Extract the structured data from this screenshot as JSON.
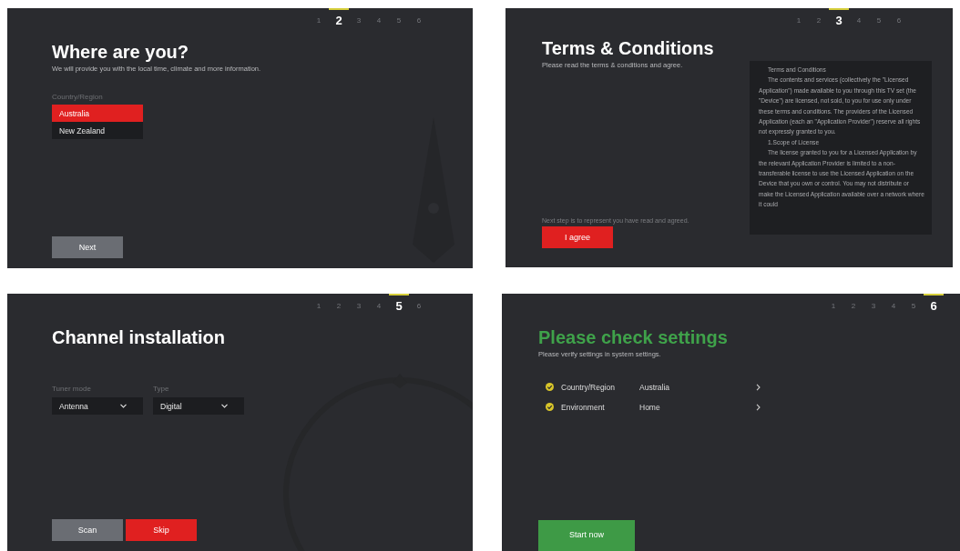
{
  "panels": [
    {
      "kind": "location",
      "steps": [
        {
          "label": "1",
          "selected": false
        },
        {
          "label": "2",
          "selected": true
        },
        {
          "label": "3",
          "selected": false
        },
        {
          "label": "4",
          "selected": false
        },
        {
          "label": "5",
          "selected": false
        },
        {
          "label": "6",
          "selected": false
        }
      ],
      "title": "Where are you?",
      "subtitle": "We will provide you with the local time, climate and more information.",
      "field_label": "Country/Region",
      "options": [
        {
          "label": "Australia",
          "selected": true
        },
        {
          "label": "New Zealand",
          "selected": false
        }
      ],
      "buttons": [
        {
          "label": "Next",
          "kind": "secondary"
        }
      ]
    },
    {
      "kind": "terms",
      "steps": [
        {
          "label": "1",
          "selected": false
        },
        {
          "label": "2",
          "selected": false
        },
        {
          "label": "3",
          "selected": true
        },
        {
          "label": "4",
          "selected": false
        },
        {
          "label": "5",
          "selected": false
        },
        {
          "label": "6",
          "selected": false
        }
      ],
      "title": "Terms & Conditions",
      "subtitle": "Please read the terms & conditions and agree.",
      "terms": [
        "Terms and Conditions",
        "The contents and services (collectively the \"Licensed Application\") made available to you through this TV set (the \"Device\") are licensed, not sold, to you for use only under these terms and conditions. The providers of the Licensed Application (each an \"Application Provider\") reserve all rights not expressly granted to you.",
        "1.Scope of License",
        "The license granted to you for a Licensed Application by the relevant Application Provider is limited to a non-transferable license to use the Licensed Application on the Device that you own or control. You may not distribute or make the Licensed Application available over a network where it could"
      ],
      "note": "Next step is to represent you have read and agreed.",
      "buttons": [
        {
          "label": "I agree",
          "kind": "primary"
        }
      ]
    },
    {
      "kind": "channels",
      "steps": [
        {
          "label": "1",
          "selected": false
        },
        {
          "label": "2",
          "selected": false
        },
        {
          "label": "3",
          "selected": false
        },
        {
          "label": "4",
          "selected": false
        },
        {
          "label": "5",
          "selected": true
        },
        {
          "label": "6",
          "selected": false
        }
      ],
      "title": "Channel installation",
      "dropdowns": [
        {
          "label": "Tuner mode",
          "value": "Antenna"
        },
        {
          "label": "Type",
          "value": "Digital"
        }
      ],
      "buttons": [
        {
          "label": "Scan",
          "kind": "secondary"
        },
        {
          "label": "Skip",
          "kind": "primary"
        }
      ]
    },
    {
      "kind": "summary",
      "steps": [
        {
          "label": "1",
          "selected": false
        },
        {
          "label": "2",
          "selected": false
        },
        {
          "label": "3",
          "selected": false
        },
        {
          "label": "4",
          "selected": false
        },
        {
          "label": "5",
          "selected": false
        },
        {
          "label": "6",
          "selected": true
        }
      ],
      "title": "Please check settings",
      "subtitle": "Please verify settings in system settings.",
      "settings": [
        {
          "label": "Country/Region",
          "value": "Australia",
          "checked": true
        },
        {
          "label": "Environment",
          "value": "Home",
          "checked": true
        }
      ],
      "buttons": [
        {
          "label": "Start now",
          "kind": "confirm"
        }
      ]
    }
  ]
}
